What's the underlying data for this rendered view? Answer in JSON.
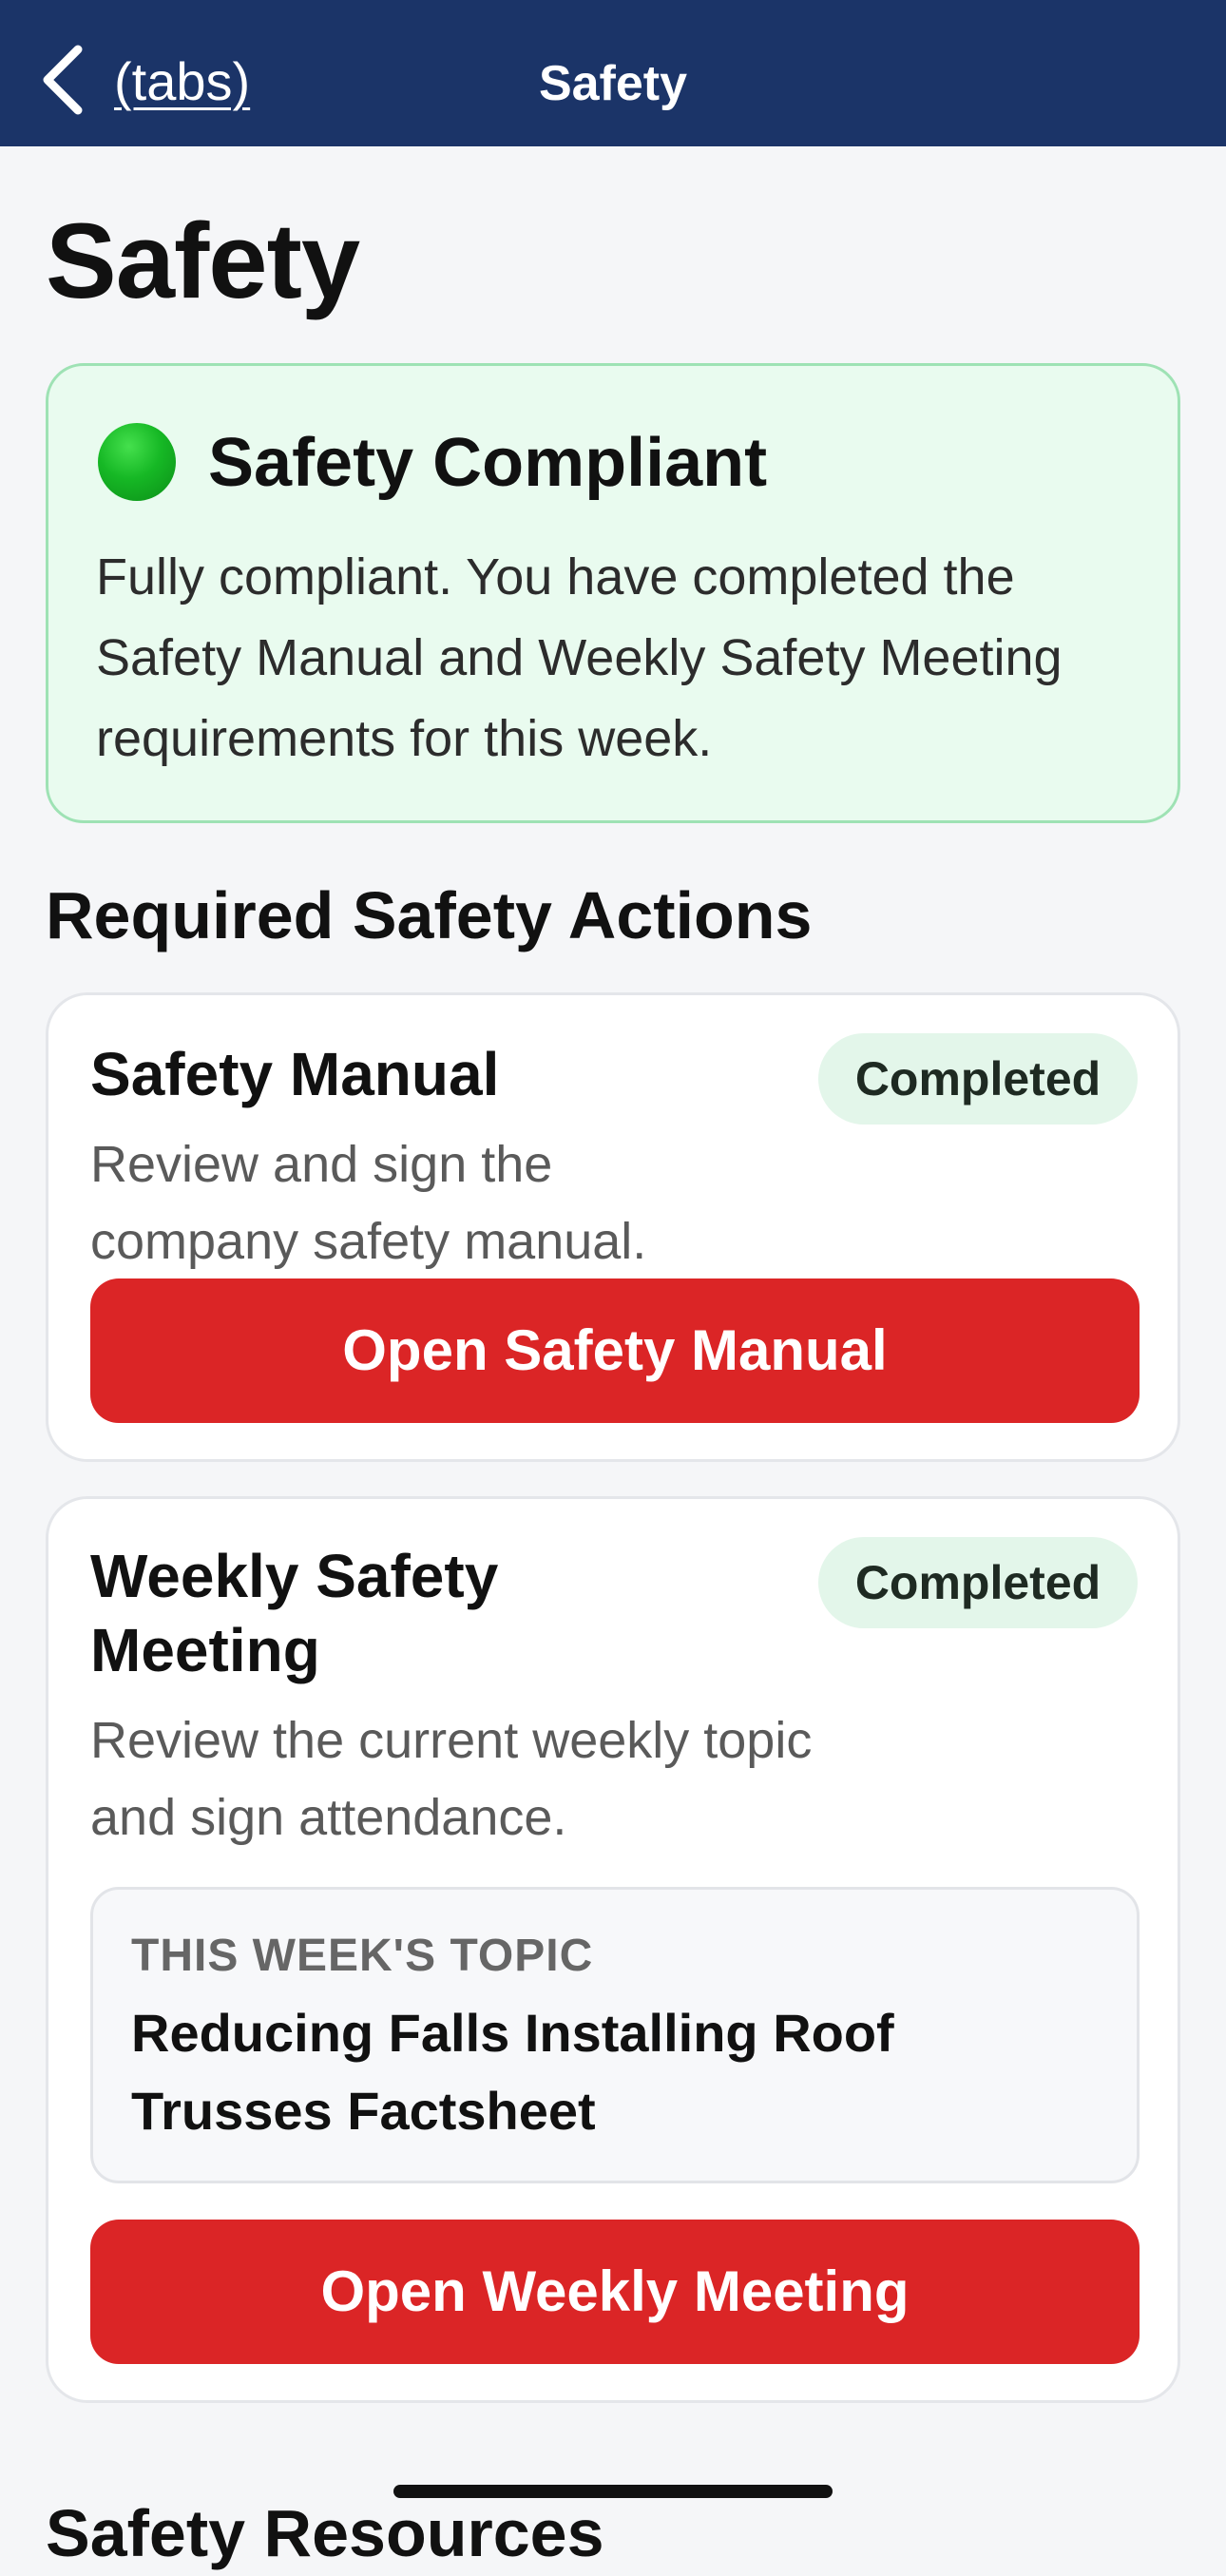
{
  "nav": {
    "back_label": "(tabs)",
    "title": "Safety",
    "back_icon": "chevron-left-icon"
  },
  "page": {
    "title": "Safety"
  },
  "status": {
    "icon": "green-circle",
    "color": "#16b825",
    "title": "Safety Compliant",
    "description": "Fully compliant. You have completed the Safety Manual and Weekly Safety Meeting requirements for this week."
  },
  "required_actions": {
    "heading": "Required Safety Actions",
    "items": [
      {
        "title": "Safety Manual",
        "description": "Review and sign the company safety manual.",
        "status": "Completed",
        "button_label": "Open Safety Manual"
      },
      {
        "title": "Weekly Safety Meeting",
        "description": "Review the current weekly topic and sign attendance.",
        "status": "Completed",
        "topic_label": "THIS WEEK'S TOPIC",
        "topic_title": "Reducing Falls Installing Roof Trusses Factsheet",
        "button_label": "Open Weekly Meeting"
      }
    ]
  },
  "next_section": {
    "heading": "Safety Resources"
  },
  "colors": {
    "nav_bg": "#1b3468",
    "accent_red": "#db2526",
    "success_bg": "#e9fbef",
    "badge_bg": "#e3f6ea"
  }
}
